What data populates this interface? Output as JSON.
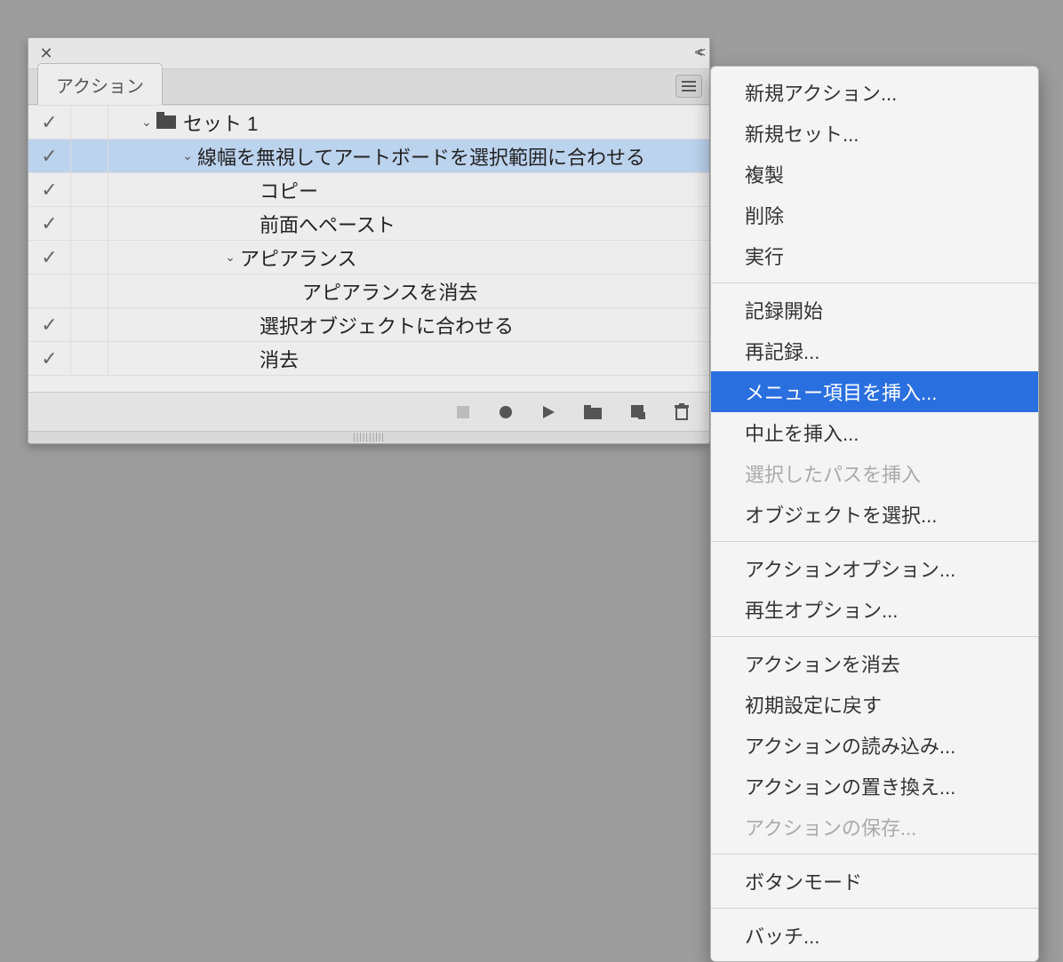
{
  "panel": {
    "tab_label": "アクション",
    "rows": [
      {
        "label": "セット 1"
      },
      {
        "label": "線幅を無視してアートボードを選択範囲に合わせる"
      },
      {
        "label": "コピー"
      },
      {
        "label": "前面へペースト"
      },
      {
        "label": "アピアランス"
      },
      {
        "label": "アピアランスを消去"
      },
      {
        "label": "選択オブジェクトに合わせる"
      },
      {
        "label": "消去"
      }
    ]
  },
  "menu": {
    "items": [
      {
        "label": "新規アクション..."
      },
      {
        "label": "新規セット..."
      },
      {
        "label": "複製"
      },
      {
        "label": "削除"
      },
      {
        "label": "実行"
      },
      {
        "label": "記録開始"
      },
      {
        "label": "再記録..."
      },
      {
        "label": "メニュー項目を挿入..."
      },
      {
        "label": "中止を挿入..."
      },
      {
        "label": "選択したパスを挿入"
      },
      {
        "label": "オブジェクトを選択..."
      },
      {
        "label": "アクションオプション..."
      },
      {
        "label": "再生オプション..."
      },
      {
        "label": "アクションを消去"
      },
      {
        "label": "初期設定に戻す"
      },
      {
        "label": "アクションの読み込み..."
      },
      {
        "label": "アクションの置き換え..."
      },
      {
        "label": "アクションの保存..."
      },
      {
        "label": "ボタンモード"
      },
      {
        "label": "バッチ..."
      }
    ]
  }
}
